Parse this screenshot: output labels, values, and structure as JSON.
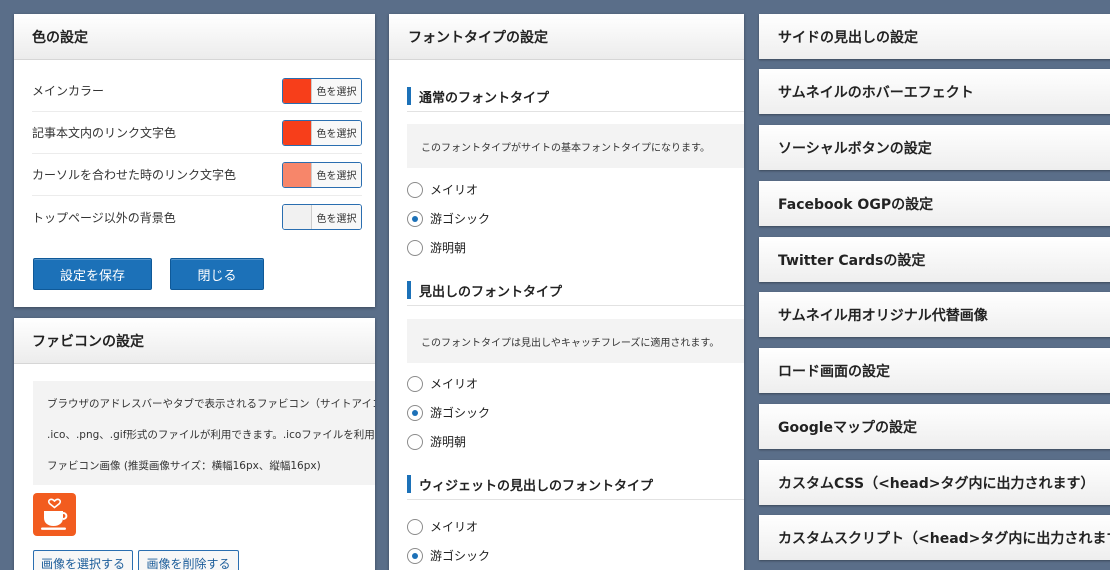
{
  "color_panel": {
    "title": "色の設定",
    "rows": [
      {
        "label": "メインカラー",
        "color": "#f73e1a",
        "button": "色を選択"
      },
      {
        "label": "記事本文内のリンク文字色",
        "color": "#f73e1a",
        "button": "色を選択"
      },
      {
        "label": "カーソルを合わせた時のリンク文字色",
        "color": "#f7866a",
        "button": "色を選択"
      },
      {
        "label": "トップページ以外の背景色",
        "color": "#f1f1f1",
        "button": "色を選択"
      }
    ],
    "save_label": "設定を保存",
    "close_label": "閉じる"
  },
  "favicon_panel": {
    "title": "ファビコンの設定",
    "info_lines": [
      "ブラウザのアドレスバーやタブで表示されるファビコン（サイトアイコン）",
      ".ico、.png、.gif形式のファイルが利用できます。.icoファイルを利用される",
      "ファビコン画像 (推奨画像サイズ：横幅16px、縦幅16px)"
    ],
    "select_label": "画像を選択する",
    "delete_label": "画像を削除する"
  },
  "font_panel": {
    "title": "フォントタイプの設定",
    "sections": [
      {
        "title": "通常のフォントタイプ",
        "description": "このフォントタイプがサイトの基本フォントタイプになります。",
        "options": [
          "メイリオ",
          "游ゴシック",
          "游明朝"
        ],
        "selected": 1
      },
      {
        "title": "見出しのフォントタイプ",
        "description": "このフォントタイプは見出しやキャッチフレーズに適用されます。",
        "options": [
          "メイリオ",
          "游ゴシック",
          "游明朝"
        ],
        "selected": 1
      },
      {
        "title": "ウィジェットの見出しのフォントタイプ",
        "options": [
          "メイリオ",
          "游ゴシック"
        ],
        "selected": 1
      }
    ]
  },
  "accordion": [
    "サイドの見出しの設定",
    "サムネイルのホバーエフェクト",
    "ソーシャルボタンの設定",
    "Facebook OGPの設定",
    "Twitter Cardsの設定",
    "サムネイル用オリジナル代替画像",
    "ロード画面の設定",
    "Googleマップの設定",
    "カスタムCSS（<head>タグ内に出力されます）",
    "カスタムスクリプト（<head>タグ内に出力されます）"
  ]
}
